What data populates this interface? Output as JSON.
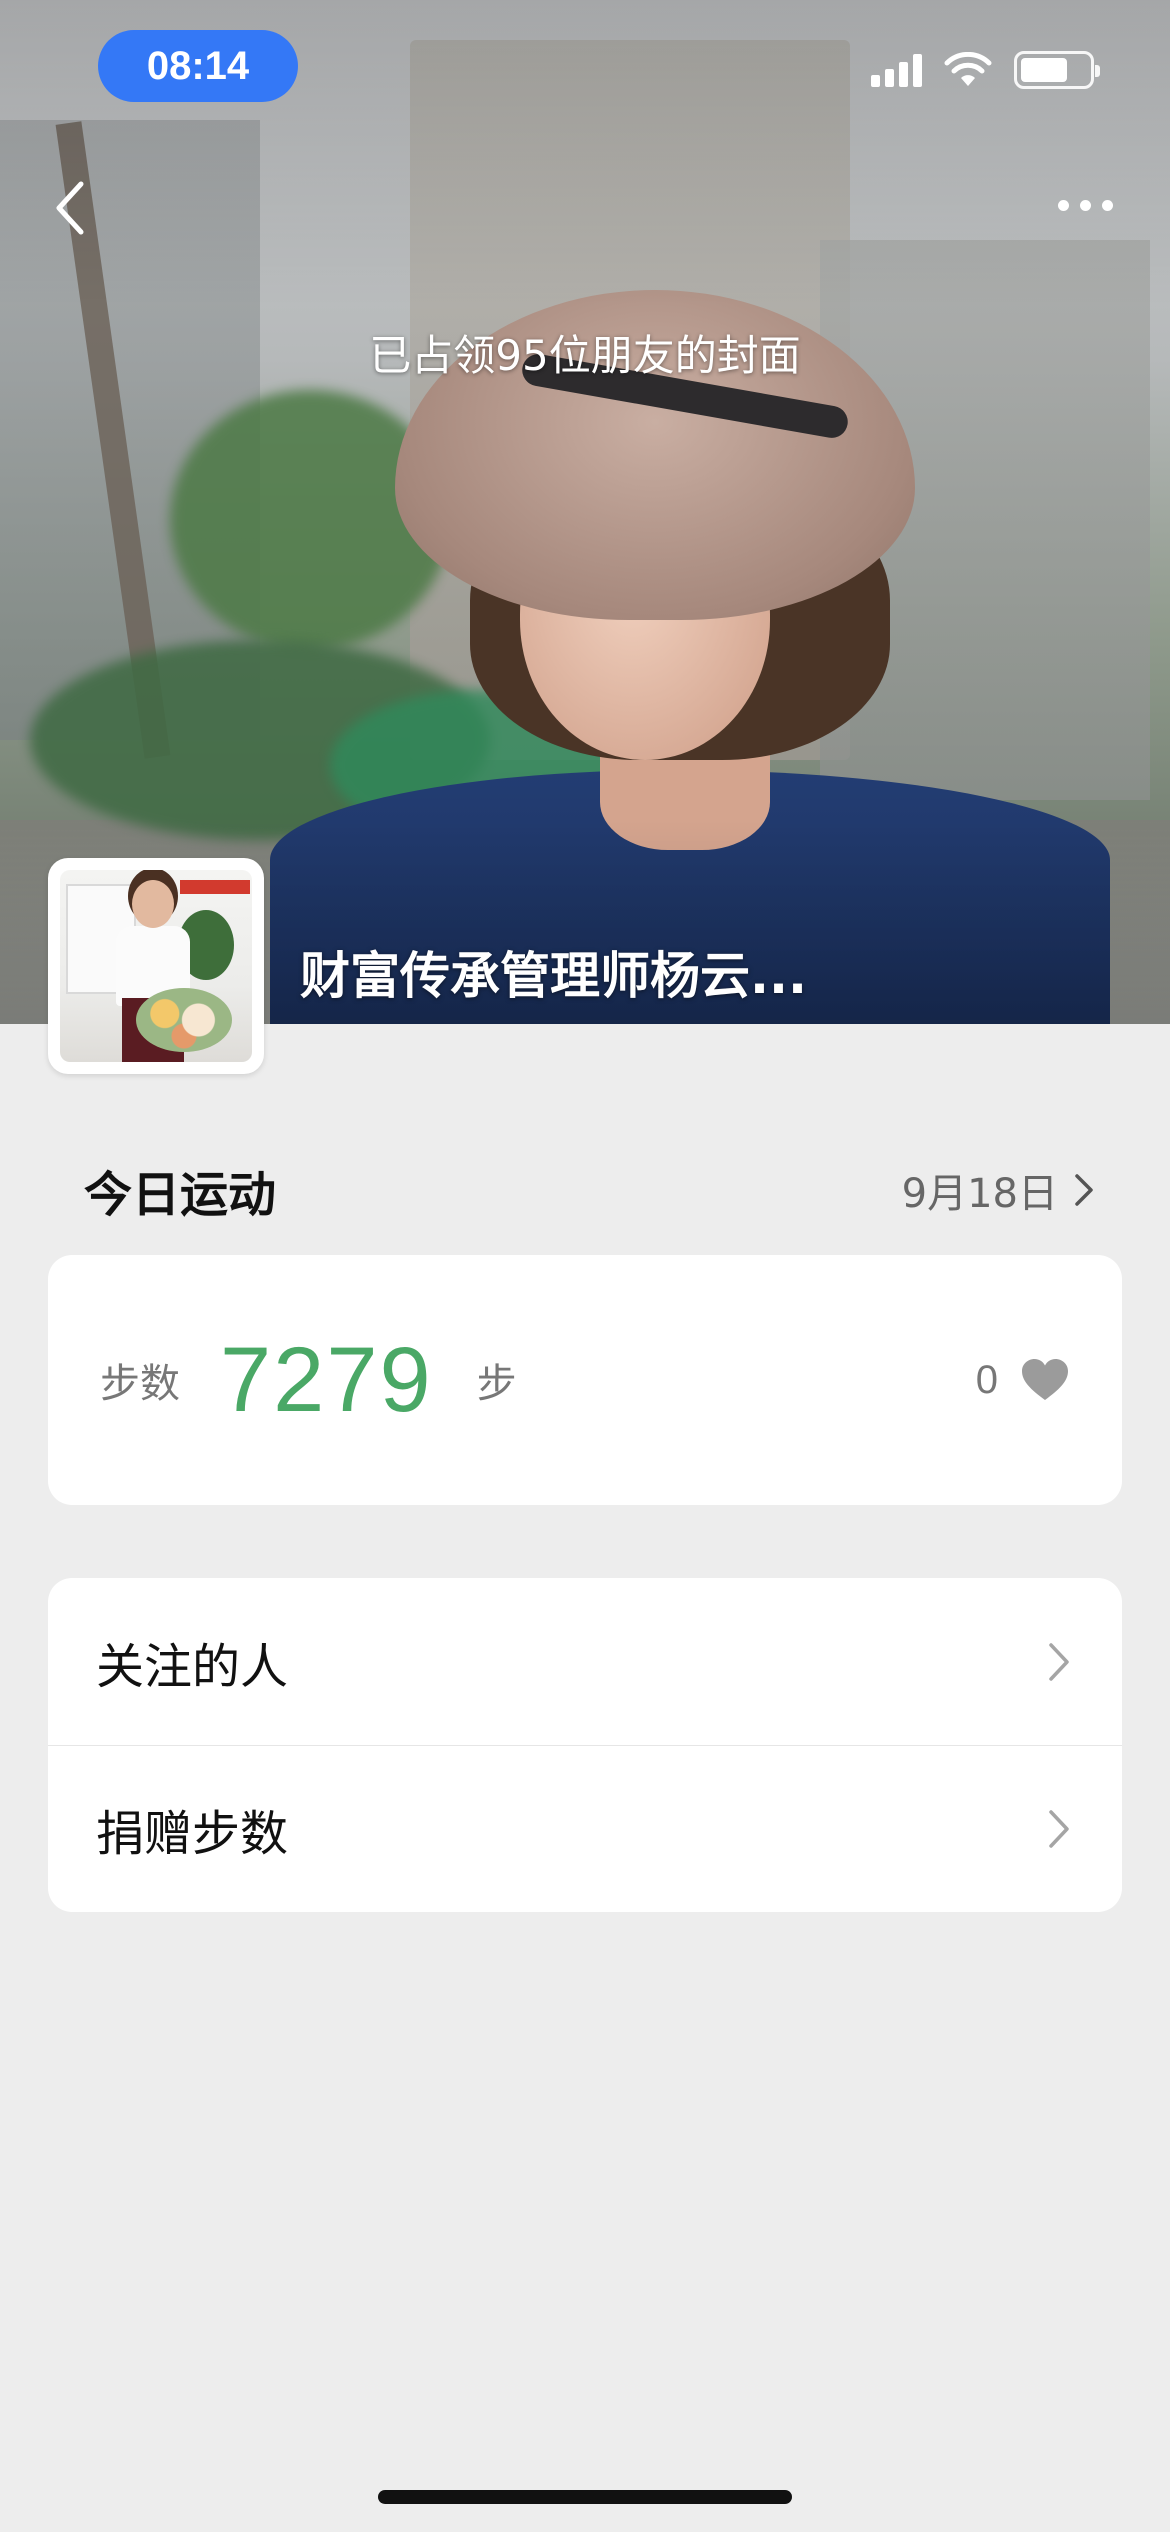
{
  "status_bar": {
    "time": "08:14"
  },
  "cover": {
    "note": "已占领95位朋友的封面",
    "user_name": "财富传承管理师杨云..."
  },
  "today": {
    "title": "今日运动",
    "date": "9月18日"
  },
  "steps": {
    "label": "步数",
    "value": "7279",
    "unit": "步",
    "likes": "0"
  },
  "menu": [
    {
      "label": "关注的人"
    },
    {
      "label": "捐赠步数"
    }
  ],
  "colors": {
    "accent_green": "#4aa866",
    "time_pill": "#3478f6",
    "background": "#ededed"
  },
  "icons": [
    "back-icon",
    "more-icon",
    "chevron-right-icon",
    "heart-icon",
    "signal-icon",
    "wifi-icon",
    "battery-icon"
  ]
}
